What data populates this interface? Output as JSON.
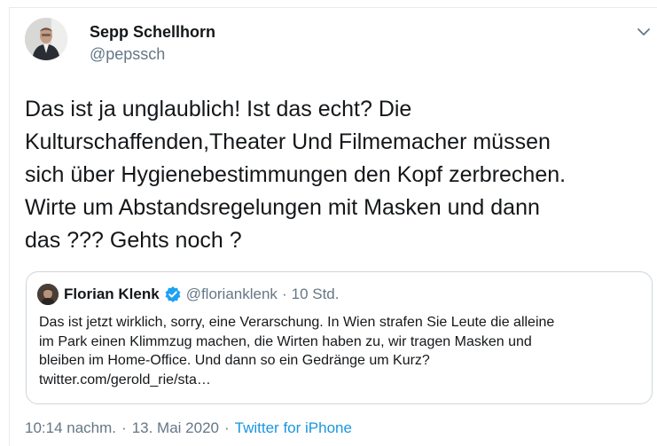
{
  "author": {
    "name": "Sepp Schellhorn",
    "handle": "@pepssch"
  },
  "tweet": {
    "text_lines": [
      "Das ist ja unglaublich! Ist das echt? Die",
      "Kulturschaffenden,Theater Und Filmemacher müssen",
      "sich über Hygienebestimmungen den Kopf zerbrechen.",
      "Wirte um Abstandsregelungen mit Masken und dann",
      "das ??? Gehts noch ?"
    ]
  },
  "quoted_tweet": {
    "name": "Florian Klenk",
    "handle": "@florianklenk",
    "time": "10 Std.",
    "text_lines": [
      "Das ist jetzt wirklich, sorry, eine Verarschung. In Wien strafen Sie Leute die alleine",
      "im Park einen Klimmzug machen, die Wirten haben zu, wir tragen Masken  und",
      "bleiben im Home-Office. Und dann so ein Gedränge um Kurz?",
      "twitter.com/gerold_rie/sta…"
    ]
  },
  "meta": {
    "time": "10:14 nachm.",
    "date": "13. Mai 2020",
    "source": "Twitter for iPhone",
    "separator": "·"
  },
  "icons": {
    "caret": "chevron-down-icon",
    "verified": "verified-badge-icon"
  },
  "colors": {
    "text": "#14171a",
    "secondary": "#657786",
    "link": "#1b95e0",
    "verified": "#1da1f2",
    "border": "#ccd6dd"
  }
}
